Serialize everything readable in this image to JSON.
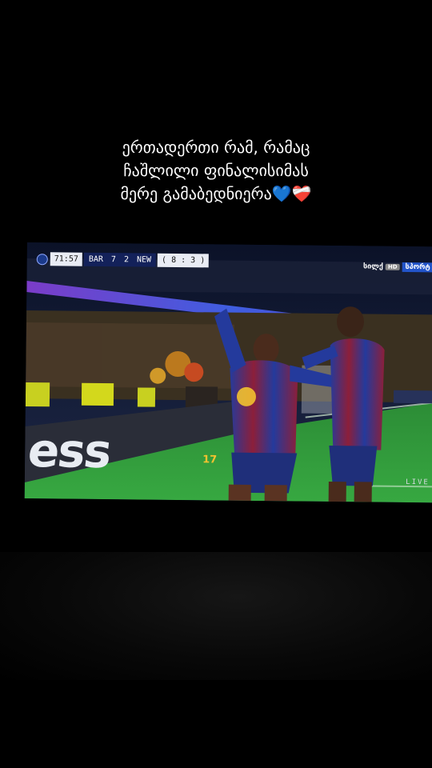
{
  "caption": {
    "lines": [
      "ერთადერთი რამ, რამაც",
      "ჩაშლილი ფინალისიმას",
      "მერე გამაბედნიერა💙❤️‍🩹"
    ]
  },
  "scoreboard": {
    "clock": "71:57",
    "home_team": "BAR",
    "home_score": "7",
    "away_score": "2",
    "away_team": "NEW",
    "aggregate": "( 8 : 3 )"
  },
  "broadcaster": {
    "name": "სილქ",
    "hd_badge": "HD",
    "channel": "სპორტ"
  },
  "live_label": "LIVE",
  "ad_board_text": "ess",
  "colors": {
    "background": "#000000",
    "caption_text": "#ffffff",
    "pitch": "#2f9a3a",
    "kit_blue": "#243a9c",
    "kit_garnet": "#8c1f3a",
    "scorebug_bg": "#13215a"
  }
}
